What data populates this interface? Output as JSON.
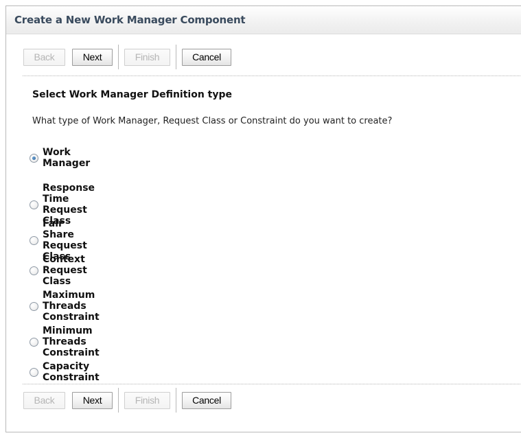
{
  "panel": {
    "title": "Create a New Work Manager Component"
  },
  "toolbar": {
    "back_label": "Back",
    "next_label": "Next",
    "finish_label": "Finish",
    "cancel_label": "Cancel"
  },
  "form": {
    "heading": "Select Work Manager Definition type",
    "question": "What type of Work Manager, Request Class or Constraint do you want to create?",
    "selected": "Work Manager",
    "options": [
      {
        "label": "Work Manager",
        "checked": true
      },
      {
        "label": "Response Time Request Class",
        "checked": false
      },
      {
        "label": "Fair Share Request Class",
        "checked": false
      },
      {
        "label": "Context Request Class",
        "checked": false
      },
      {
        "label": "Maximum Threads Constraint",
        "checked": false
      },
      {
        "label": "Minimum Threads Constraint",
        "checked": false
      },
      {
        "label": "Capacity Constraint",
        "checked": false
      }
    ]
  },
  "colors": {
    "title_text": "#3a4b5e",
    "disabled_text": "#b5b5b5",
    "radio_selected": "#215b94"
  }
}
